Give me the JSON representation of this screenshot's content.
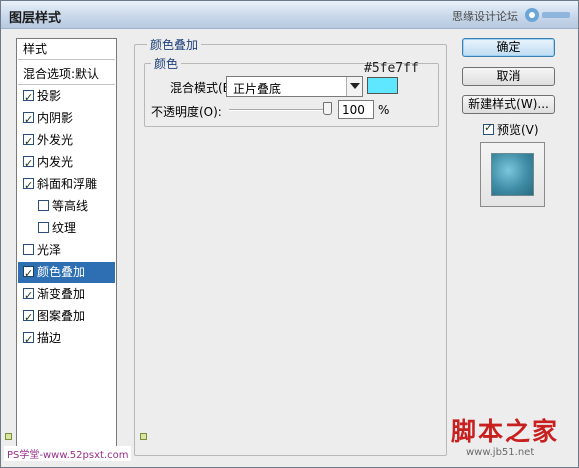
{
  "window": {
    "title": "图层样式"
  },
  "watermark": {
    "top_text": "思缘设计论坛",
    "top_url": "www.missyuan.com",
    "bottom_left": "PS学堂-www.52psxt.com",
    "bottom_right": "脚本之家",
    "bottom_url": "www.jb51.net"
  },
  "style_list": {
    "header": "样式",
    "blend_default": "混合选项:默认",
    "items": [
      {
        "label": "投影",
        "checked": true
      },
      {
        "label": "内阴影",
        "checked": true
      },
      {
        "label": "外发光",
        "checked": true
      },
      {
        "label": "内发光",
        "checked": true
      },
      {
        "label": "斜面和浮雕",
        "checked": true
      },
      {
        "label": "等高线",
        "checked": false,
        "indent": true
      },
      {
        "label": "纹理",
        "checked": false,
        "indent": true
      },
      {
        "label": "光泽",
        "checked": false
      },
      {
        "label": "颜色叠加",
        "checked": true,
        "selected": true
      },
      {
        "label": "渐变叠加",
        "checked": true
      },
      {
        "label": "图案叠加",
        "checked": true
      },
      {
        "label": "描边",
        "checked": true
      }
    ]
  },
  "color_overlay": {
    "group_title": "颜色叠加",
    "subgroup_title": "颜色",
    "blend_mode_label": "混合模式(B):",
    "blend_mode_value": "正片叠底",
    "color_hex_label": "#5fe7ff",
    "swatch_color": "#5fe7ff",
    "opacity_label": "不透明度(O):",
    "opacity_value": "100",
    "opacity_unit": "%",
    "opacity_fraction": 1.0
  },
  "buttons": {
    "ok": "确定",
    "cancel": "取消",
    "new_style": "新建样式(W)...",
    "preview_label": "预览(V)",
    "preview_checked": true
  }
}
